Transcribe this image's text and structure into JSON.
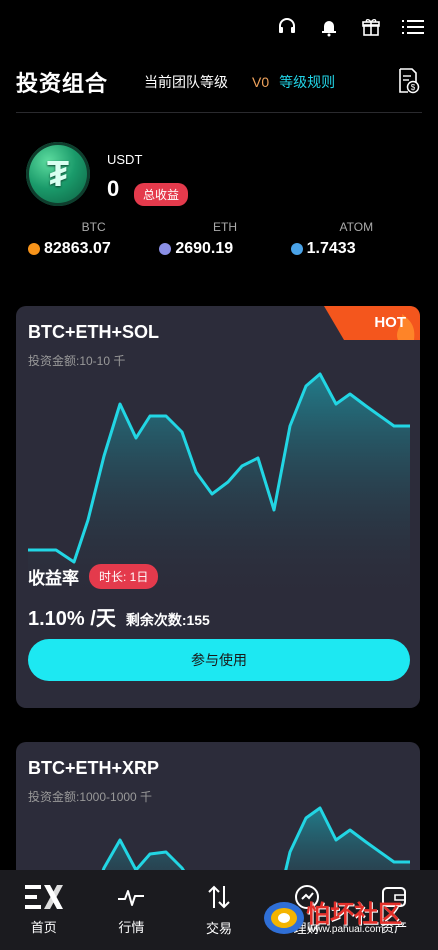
{
  "top_icons": [
    "headset-icon",
    "bell-icon",
    "gift-icon",
    "menu-icon"
  ],
  "header": {
    "title": "投资组合",
    "team_level_label": "当前团队等级",
    "level": "V0",
    "rules_link": "等级规则"
  },
  "summary": {
    "currency": "USDT",
    "total": "0",
    "total_badge": "总收益"
  },
  "assets": [
    {
      "name": "BTC",
      "value": "82863.07",
      "color": "#f7931a"
    },
    {
      "name": "ETH",
      "value": "2690.19",
      "color": "#8a8fe6"
    },
    {
      "name": "ATOM",
      "value": "1.7433",
      "color": "#4aa3e8"
    }
  ],
  "products": [
    {
      "name": "BTC+ETH+SOL",
      "invest_range": "投资金额:10-10 千",
      "hot": "HOT",
      "yield_label": "收益率",
      "duration": "时长: 1日",
      "rate": "1.10% /天",
      "remaining": "剩余次数:155",
      "button": "参与使用"
    },
    {
      "name": "BTC+ETH+XRP",
      "invest_range": "投资金额:1000-1000 千"
    }
  ],
  "colors": {
    "accent": "#1de8f2",
    "badge": "#e43a4c",
    "level": "#f0a35c"
  },
  "tabs": [
    {
      "label": "首页",
      "icon": "ex-logo-icon"
    },
    {
      "label": "行情",
      "icon": "pulse-icon"
    },
    {
      "label": "交易",
      "icon": "swap-icon"
    },
    {
      "label": "理财",
      "icon": "finance-icon"
    },
    {
      "label": "资产",
      "icon": "wallet-icon"
    }
  ],
  "watermark": {
    "brand": "怕坏社区",
    "url": "www.pahuai.com"
  }
}
